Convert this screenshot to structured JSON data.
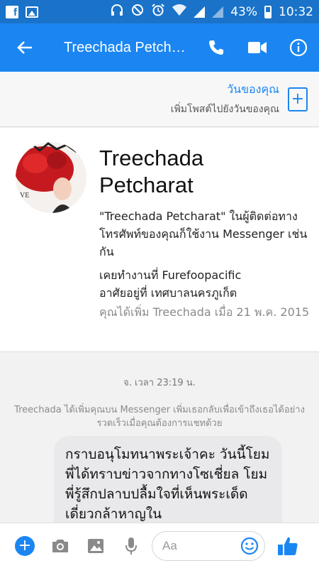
{
  "statusbar": {
    "battery": "43%",
    "time": "10:32",
    "left_icons": [
      "facebook-icon",
      "gallery-icon"
    ],
    "right_icons": [
      "headphones-icon",
      "dnd-icon",
      "alarm-icon",
      "wifi-icon",
      "signal-icon",
      "battery-icon"
    ]
  },
  "appbar": {
    "title": "Treechada Petch…",
    "icons": [
      "back-arrow-icon",
      "phone-icon",
      "video-icon",
      "info-icon"
    ],
    "color": "#1b86f2"
  },
  "your_day": {
    "title": "วันของคุณ",
    "subtitle": "เพิ่มโพสต์ไปยังวันของคุณ",
    "add_icon": "plus-icon"
  },
  "profile": {
    "name_line1": "Treechada",
    "name_line2": "Petcharat",
    "phone_contact": "\"Treechada Petcharat\" ในผู้ติดต่อทางโทรศัพท์ของคุณก็ใช้งาน Messenger เช่นกัน",
    "work": "เคยทำงานที่ Furefoopacific",
    "lives": "อาศัยอยู่ที่ เทศบาลนครภูเก็ต",
    "added": "คุณได้เพิ่ม Treechada เมื่อ 21 พ.ค. 2015"
  },
  "chat": {
    "timestamp": "จ. เวลา 23:19 น.",
    "system_message": "Treechada ได้เพิ่มคุณบน Messenger เพิ่มเธอกลับเพื่อเข้าถึงเธอได้อย่างรวดเร็วเมื่อคุณต้องการแชทด้วย",
    "bubble_text": "กราบอนุโมทนาพระเจ้าคะ วันนี้โยมพี่ได้ทราบข่าวจากทางโซเชี่ยล โยมพี่รู้สึกปลาบปลื้มใจที่เห็นพระเด็ดเดี่ยวกล้าหาญใน"
  },
  "composer": {
    "placeholder": "Aa",
    "icons": [
      "plus-icon",
      "camera-icon",
      "image-icon",
      "microphone-icon",
      "emoji-icon",
      "thumbs-up-icon"
    ]
  }
}
